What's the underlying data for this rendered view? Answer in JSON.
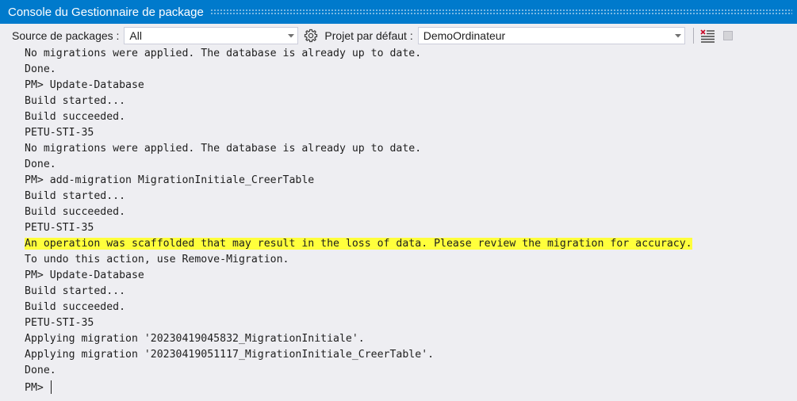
{
  "window": {
    "title": "Console du Gestionnaire de package"
  },
  "toolbar": {
    "source_label": "Source de packages :",
    "source_value": "All",
    "project_label": "Projet par défaut :",
    "project_value": "DemoOrdinateur"
  },
  "icons": {
    "settings": "gear-icon",
    "clear": "clear-console-icon",
    "stop": "stop-icon",
    "dropdown": "chevron-down-icon"
  },
  "colors": {
    "titlebar": "#007acc",
    "background": "#eeeef2",
    "highlight": "#ffff3c"
  },
  "console": {
    "lines": [
      {
        "text": "No migrations were applied. The database is already up to date."
      },
      {
        "text": "Done."
      },
      {
        "text": "PM> Update-Database"
      },
      {
        "text": "Build started..."
      },
      {
        "text": "Build succeeded."
      },
      {
        "text": "PETU-STI-35"
      },
      {
        "text": "No migrations were applied. The database is already up to date."
      },
      {
        "text": "Done."
      },
      {
        "text": "PM> add-migration MigrationInitiale_CreerTable"
      },
      {
        "text": "Build started..."
      },
      {
        "text": "Build succeeded."
      },
      {
        "text": "PETU-STI-35"
      },
      {
        "text": "An operation was scaffolded that may result in the loss of data. Please review the migration for accuracy.",
        "highlight": true
      },
      {
        "text": "To undo this action, use Remove-Migration."
      },
      {
        "text": "PM> Update-Database"
      },
      {
        "text": "Build started..."
      },
      {
        "text": "Build succeeded."
      },
      {
        "text": "PETU-STI-35"
      },
      {
        "text": "Applying migration '20230419045832_MigrationInitiale'."
      },
      {
        "text": "Applying migration '20230419051117_MigrationInitiale_CreerTable'."
      },
      {
        "text": "Done."
      }
    ],
    "prompt": "PM> "
  }
}
